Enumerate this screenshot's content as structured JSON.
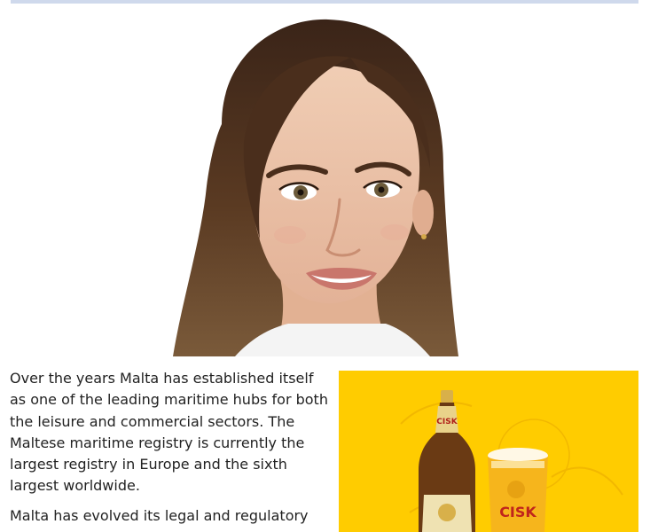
{
  "article": {
    "paragraphs": [
      "Over the years Malta has established itself as one of the leading maritime hubs for both the leisure and commercial sectors. The Maltese maritime registry is currently the largest registry in Europe and the sixth largest worldwide.",
      "Malta has evolved its legal and regulatory"
    ]
  },
  "ad": {
    "brand_label": "CISK",
    "bottle_label": "CISK",
    "glass_label": "CISK",
    "background_color": "#ffcc00"
  },
  "colors": {
    "border": "#cfd9ec",
    "text": "#222222"
  }
}
